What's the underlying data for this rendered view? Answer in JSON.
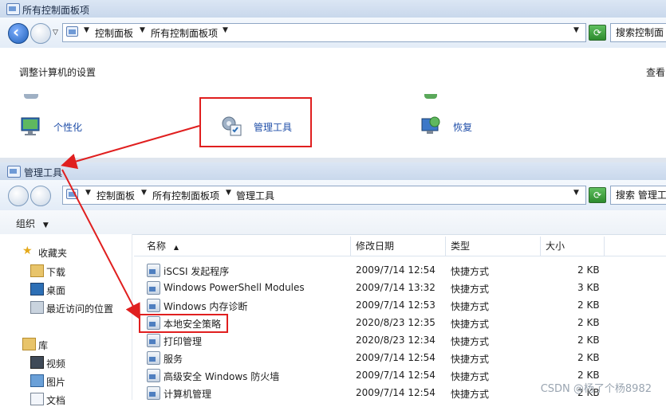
{
  "top_window": {
    "title": "所有控制面板项",
    "breadcrumb": [
      "控制面板",
      "所有控制面板项"
    ],
    "search_placeholder": "搜索控制面",
    "heading": "调整计算机的设置",
    "view_label": "查看",
    "items": [
      {
        "label": "个性化",
        "icon": "personalize-icon"
      },
      {
        "label": "管理工具",
        "icon": "admin-tools-icon"
      },
      {
        "label": "恢复",
        "icon": "recovery-icon"
      }
    ]
  },
  "explorer": {
    "title": "管理工具",
    "breadcrumb": [
      "控制面板",
      "所有控制面板项",
      "管理工具"
    ],
    "search_placeholder": "搜索 管理工",
    "organize_label": "组织",
    "columns": {
      "name": "名称",
      "modified": "修改日期",
      "type": "类型",
      "size": "大小"
    },
    "nav": [
      {
        "label": "收藏夹",
        "icon": "star-icon"
      },
      {
        "label": "下载",
        "icon": "download-folder-icon"
      },
      {
        "label": "桌面",
        "icon": "desktop-icon"
      },
      {
        "label": "最近访问的位置",
        "icon": "recent-places-icon"
      },
      {
        "label": "库",
        "icon": "library-icon"
      },
      {
        "label": "视频",
        "icon": "video-icon"
      },
      {
        "label": "图片",
        "icon": "pictures-icon"
      },
      {
        "label": "文档",
        "icon": "documents-icon"
      }
    ],
    "files": [
      {
        "name": "iSCSI 发起程序",
        "modified": "2009/7/14 12:54",
        "type": "快捷方式",
        "size": "2 KB"
      },
      {
        "name": "Windows PowerShell Modules",
        "modified": "2009/7/14 13:32",
        "type": "快捷方式",
        "size": "3 KB"
      },
      {
        "name": "Windows 内存诊断",
        "modified": "2009/7/14 12:53",
        "type": "快捷方式",
        "size": "2 KB"
      },
      {
        "name": "本地安全策略",
        "modified": "2020/8/23 12:35",
        "type": "快捷方式",
        "size": "2 KB"
      },
      {
        "name": "打印管理",
        "modified": "2020/8/23 12:34",
        "type": "快捷方式",
        "size": "2 KB"
      },
      {
        "name": "服务",
        "modified": "2009/7/14 12:54",
        "type": "快捷方式",
        "size": "2 KB"
      },
      {
        "name": "高级安全 Windows 防火墙",
        "modified": "2009/7/14 12:54",
        "type": "快捷方式",
        "size": "2 KB"
      },
      {
        "name": "计算机管理",
        "modified": "2009/7/14 12:54",
        "type": "快捷方式",
        "size": "2 KB"
      }
    ]
  },
  "watermark": "CSDN @杨了个杨8982",
  "colors": {
    "highlight": "#e01f1f",
    "link": "#1f4ea8",
    "titlebar": "#c9d8ec"
  }
}
